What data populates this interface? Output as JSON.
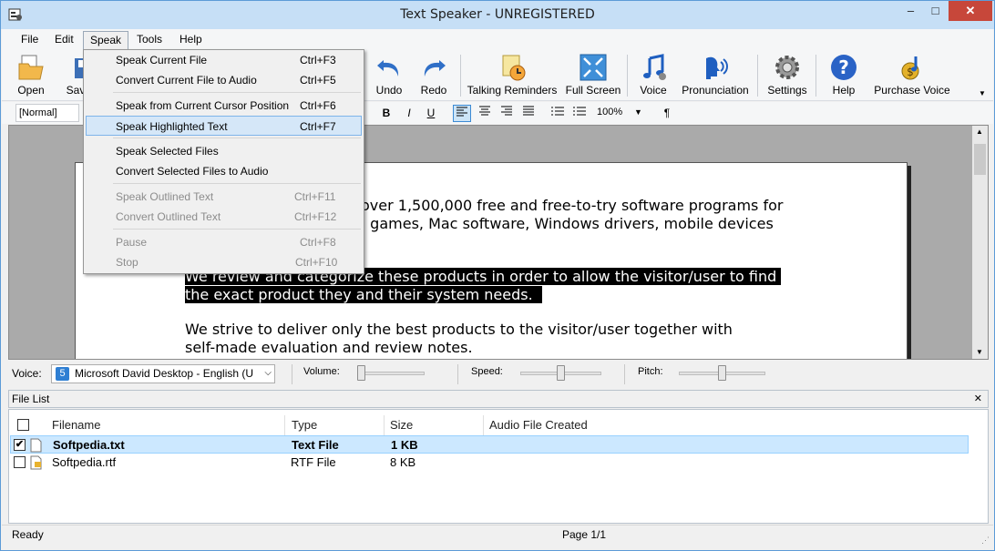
{
  "window": {
    "title": "Text Speaker - UNREGISTERED",
    "min": "‒",
    "max": "□",
    "close": "✕"
  },
  "menubar": [
    "File",
    "Edit",
    "Speak",
    "Tools",
    "Help"
  ],
  "toolbar": [
    {
      "label": "Open",
      "icon": "open-folder-icon"
    },
    {
      "label": "Sav",
      "icon": "save-icon"
    },
    {
      "label": "Undo",
      "icon": "undo-icon"
    },
    {
      "label": "Redo",
      "icon": "redo-icon"
    },
    {
      "label": "Talking Reminders",
      "icon": "reminder-clock-icon"
    },
    {
      "label": "Full Screen",
      "icon": "full-screen-icon"
    },
    {
      "label": "Voice",
      "icon": "music-note-icon"
    },
    {
      "label": "Pronunciation",
      "icon": "speaking-head-icon"
    },
    {
      "label": "Settings",
      "icon": "gear-icon"
    },
    {
      "label": "Help",
      "icon": "help-icon"
    },
    {
      "label": "Purchase Voice",
      "icon": "purchase-voice-icon"
    }
  ],
  "format": {
    "style": "[Normal]",
    "bold": "B",
    "italic": "I",
    "underline": "U",
    "zoom": "100%",
    "paragraph": "¶"
  },
  "speak_menu": {
    "items": [
      {
        "label": "Speak Current File",
        "shortcut": "Ctrl+F3",
        "disabled": false,
        "highlighted": false
      },
      {
        "label": "Convert Current File to Audio",
        "shortcut": "Ctrl+F5",
        "disabled": false,
        "highlighted": false
      },
      {
        "label": "Speak from Current Cursor Position",
        "shortcut": "Ctrl+F6",
        "disabled": false,
        "highlighted": false
      },
      {
        "label": "Speak Highlighted Text",
        "shortcut": "Ctrl+F7",
        "disabled": false,
        "highlighted": true
      },
      {
        "label": "Speak Selected Files",
        "shortcut": "",
        "disabled": false,
        "highlighted": false
      },
      {
        "label": "Convert Selected Files to Audio",
        "shortcut": "",
        "disabled": false,
        "highlighted": false
      },
      {
        "label": "Speak Outlined Text",
        "shortcut": "Ctrl+F11",
        "disabled": true,
        "highlighted": false
      },
      {
        "label": "Convert Outlined Text",
        "shortcut": "Ctrl+F12",
        "disabled": true,
        "highlighted": false
      },
      {
        "label": "Pause",
        "shortcut": "Ctrl+F8",
        "disabled": true,
        "highlighted": false
      },
      {
        "label": "Stop",
        "shortcut": "Ctrl+F10",
        "disabled": true,
        "highlighted": false
      }
    ]
  },
  "document": {
    "line1": "over 1,500,000 free and free-to-try software programs for",
    "line2": ", games, Mac software, Windows drivers, mobile devices",
    "line3": "We review and categorize these products in order to allow the visitor/user to find ",
    "line4": "the exact product they and their system needs.  ",
    "line5": "We strive to deliver only the best products to the visitor/user together with",
    "line6": "self-made evaluation and review notes."
  },
  "voice_bar": {
    "voice_label": "Voice:",
    "voice_value": "Microsoft David Desktop - English (U",
    "volume_label": "Volume:",
    "speed_label": "Speed:",
    "pitch_label": "Pitch:",
    "volume_level": 0.0,
    "speed_level": 0.5,
    "pitch_level": 0.5
  },
  "file_list": {
    "title": "File List",
    "columns": [
      "Filename",
      "Type",
      "Size",
      "Audio File Created"
    ],
    "rows": [
      {
        "checked": true,
        "filename": "Softpedia.txt",
        "type": "Text File",
        "size": "1 KB",
        "audio": "",
        "selected": true
      },
      {
        "checked": false,
        "filename": "Softpedia.rtf",
        "type": "RTF File",
        "size": "8 KB",
        "audio": "",
        "selected": false
      }
    ]
  },
  "status": {
    "left": "Ready",
    "page": "Page 1/1"
  }
}
